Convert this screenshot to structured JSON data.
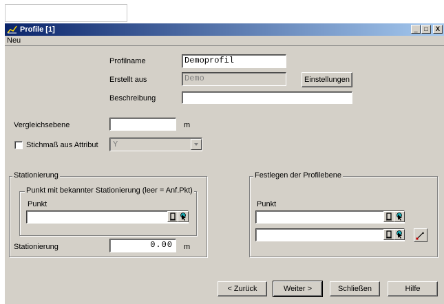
{
  "window": {
    "title": "Profile [1]",
    "controls": {
      "minimize": "_",
      "maximize": "□",
      "close": "X"
    }
  },
  "menu": {
    "items": [
      "Neu"
    ]
  },
  "form": {
    "profilname_label": "Profilname",
    "profilname_value": "Demoprofil",
    "erstellt_label": "Erstellt aus",
    "erstellt_value": "Demo",
    "einstellungen_button": "Einstellungen",
    "beschreibung_label": "Beschreibung",
    "beschreibung_value": "",
    "vergleich_label": "Vergleichsebene",
    "vergleich_value": "",
    "vergleich_unit": "m",
    "stichmass_label": "Stichmaß aus Attribut",
    "stichmass_checked": false,
    "attribut_value": "Y"
  },
  "stationierung_group": {
    "title": "Stationierung",
    "inner_title": "Punkt mit bekannter Stationierung (leer = Anf.Pkt)",
    "punkt_label": "Punkt",
    "punkt_value": "",
    "stationierung_label": "Stationierung",
    "stationierung_value": "0.00",
    "stationierung_unit": "m"
  },
  "profilebene_group": {
    "title": "Festlegen der Profilebene",
    "punkt_label": "Punkt",
    "punkt1_value": "",
    "punkt2_value": ""
  },
  "footer": {
    "back_button": "< Zurück",
    "next_button": "Weiter >",
    "close_button": "Schließen",
    "help_button": "Hilfe"
  },
  "icons": {
    "pick": "pick-point-icon",
    "select": "select-cursor-icon",
    "draw": "draw-line-icon"
  }
}
